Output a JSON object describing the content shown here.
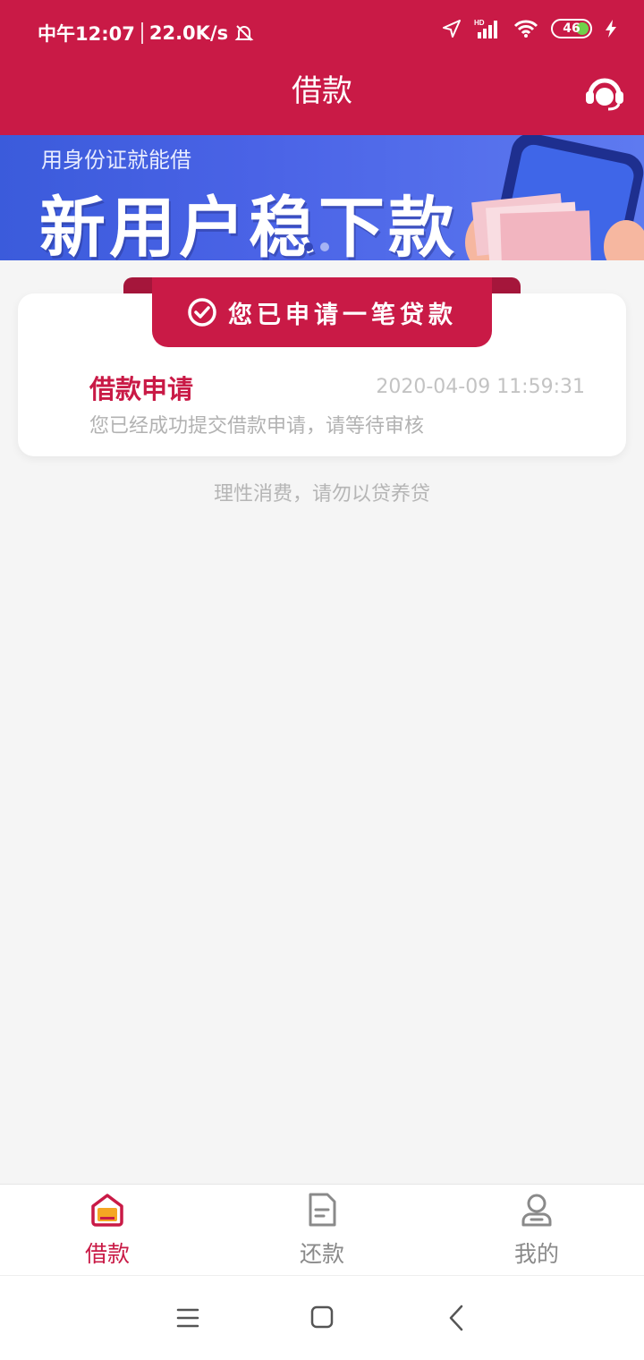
{
  "status_bar": {
    "time": "中午12:07",
    "speed": "22.0K/s",
    "battery": "46"
  },
  "header": {
    "title": "借款"
  },
  "banner": {
    "subtitle": "用身份证就能借",
    "headline": "新用户稳下款"
  },
  "card": {
    "ribbon": "您已申请一笔贷款",
    "title": "借款申请",
    "time": "2020-04-09 11:59:31",
    "description": "您已经成功提交借款申请，请等待审核"
  },
  "notice": "理性消费，请勿以贷养贷",
  "tabs": [
    {
      "label": "借款",
      "icon": "home-icon",
      "active": true
    },
    {
      "label": "还款",
      "icon": "document-icon",
      "active": false
    },
    {
      "label": "我的",
      "icon": "user-icon",
      "active": false
    }
  ],
  "colors": {
    "brand": "#c91a46",
    "banner": "#4a63e6"
  }
}
